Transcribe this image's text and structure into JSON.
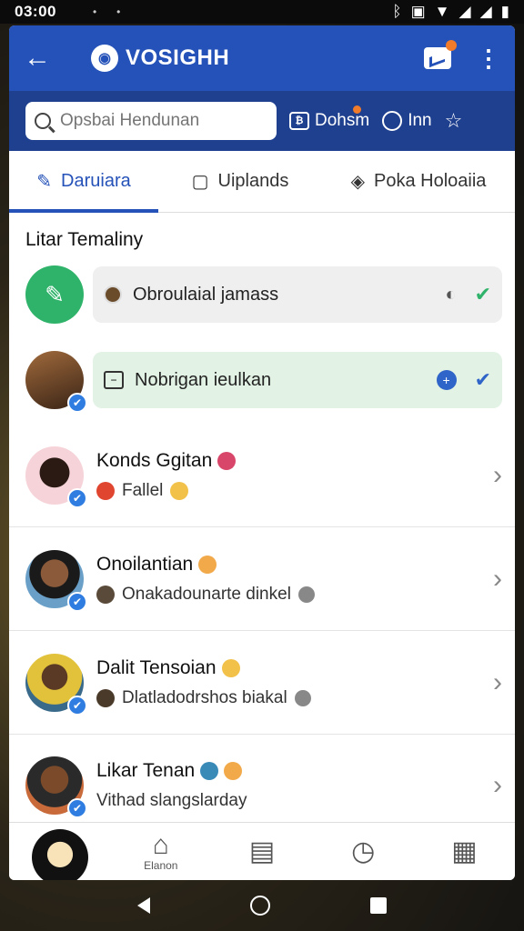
{
  "status": {
    "time": "03:00"
  },
  "appbar": {
    "title": "VOSIGHH"
  },
  "search": {
    "placeholder": "Opsbai Hendunan"
  },
  "header_buttons": [
    {
      "label": "Dohsm",
      "icon": "document-icon"
    },
    {
      "label": "Inn",
      "icon": "user-icon"
    },
    {
      "label": "",
      "icon": "star-icon"
    }
  ],
  "tabs": [
    {
      "label": "Daruiara",
      "icon": "pencil-icon"
    },
    {
      "label": "Uiplands",
      "icon": "square-icon"
    },
    {
      "label": "Poka Holoaiia",
      "icon": "tag-icon"
    }
  ],
  "section": {
    "title": "Litar Temaliny"
  },
  "pills": [
    {
      "label": "Obroulaial jamass"
    },
    {
      "label": "Nobrigan ieulkan"
    }
  ],
  "contacts": [
    {
      "name": "Konds Ggitan",
      "sub": "Fallel"
    },
    {
      "name": "Onoilantian",
      "sub": "Onakadounarte dinkel"
    },
    {
      "name": "Dalit Tensoian",
      "sub": "Dlatladodrshos biakal"
    },
    {
      "name": "Likar Tenan",
      "sub": "Vithad slangslarday"
    }
  ],
  "bottom_nav": {
    "home_label": "Elanon"
  },
  "colors": {
    "primary": "#2552b8",
    "header_dark": "#1f3f8f",
    "accent_green": "#2fb36a",
    "pill_green": "#e2f2e4",
    "orange": "#f07b2a"
  }
}
